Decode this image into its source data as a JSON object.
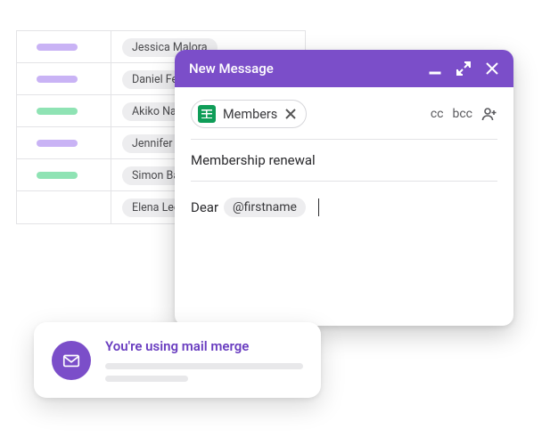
{
  "sheet": {
    "rows": [
      {
        "bar_color": "purple",
        "name": "Jessica Malora"
      },
      {
        "bar_color": "purple",
        "name": "Daniel Ferr"
      },
      {
        "bar_color": "green",
        "name": "Akiko Naka"
      },
      {
        "bar_color": "purple",
        "name": "Jennifer Ac"
      },
      {
        "bar_color": "green",
        "name": "Simon Balli"
      },
      {
        "bar_color": "",
        "name": "Elena Lee"
      }
    ]
  },
  "compose": {
    "title": "New Message",
    "recipient_label": "Members",
    "cc_label": "cc",
    "bcc_label": "bcc",
    "subject": "Membership renewal",
    "body_prefix": "Dear",
    "merge_field": "@firstname"
  },
  "notice": {
    "title": "You're using mail merge"
  },
  "colors": {
    "accent": "#7b4ec9"
  }
}
